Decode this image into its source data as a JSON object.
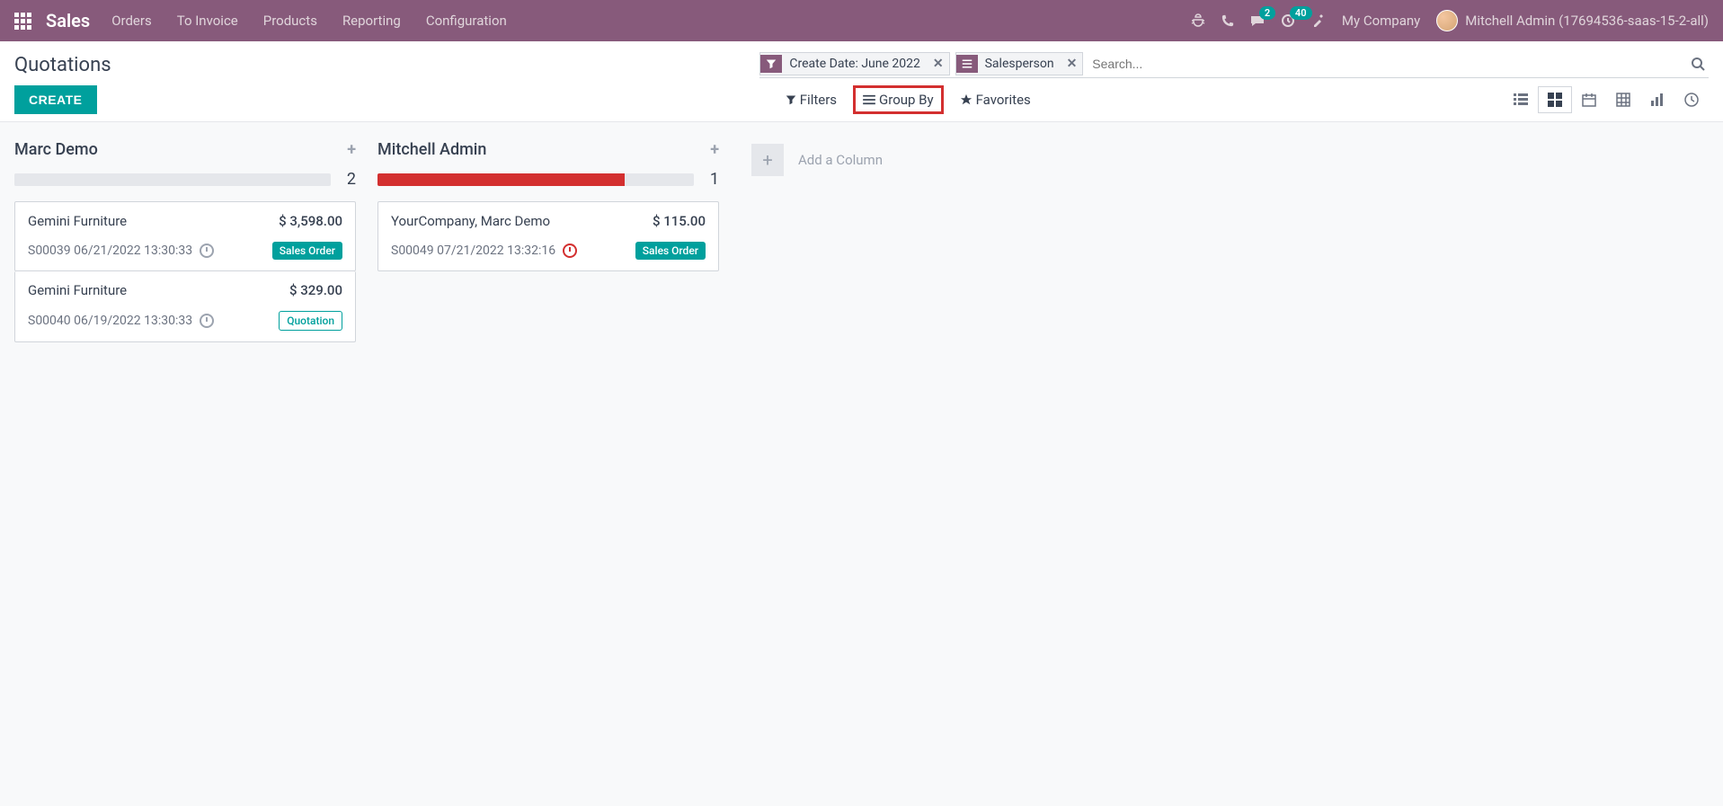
{
  "navbar": {
    "brand": "Sales",
    "menu": [
      "Orders",
      "To Invoice",
      "Products",
      "Reporting",
      "Configuration"
    ],
    "messages_badge": "2",
    "activities_badge": "40",
    "company": "My Company",
    "user": "Mitchell Admin (17694536-saas-15-2-all)"
  },
  "control": {
    "breadcrumb": "Quotations",
    "create_label": "CREATE",
    "facets": [
      {
        "type": "filter",
        "label": "Create Date: June 2022"
      },
      {
        "type": "group",
        "label": "Salesperson"
      }
    ],
    "search_placeholder": "Search...",
    "filters_label": "Filters",
    "groupby_label": "Group By",
    "favorites_label": "Favorites"
  },
  "kanban": {
    "columns": [
      {
        "title": "Marc Demo",
        "count": "2",
        "progress": [
          {
            "color": "#e5e7eb",
            "width": "75%"
          }
        ],
        "cards": [
          {
            "title": "Gemini Furniture",
            "amount": "$ 3,598.00",
            "meta": "S00039 06/21/2022 13:30:33",
            "clock_red": false,
            "status": "Sales Order",
            "status_class": "sales-order"
          },
          {
            "title": "Gemini Furniture",
            "amount": "$ 329.00",
            "meta": "S00040 06/19/2022 13:30:33",
            "clock_red": false,
            "status": "Quotation",
            "status_class": "quotation"
          }
        ]
      },
      {
        "title": "Mitchell Admin",
        "count": "1",
        "progress": [
          {
            "color": "#d32f2f",
            "width": "78%"
          }
        ],
        "cards": [
          {
            "title": "YourCompany, Marc Demo",
            "amount": "$ 115.00",
            "meta": "S00049 07/21/2022 13:32:16",
            "clock_red": true,
            "status": "Sales Order",
            "status_class": "sales-order"
          }
        ]
      }
    ],
    "add_column_label": "Add a Column"
  }
}
